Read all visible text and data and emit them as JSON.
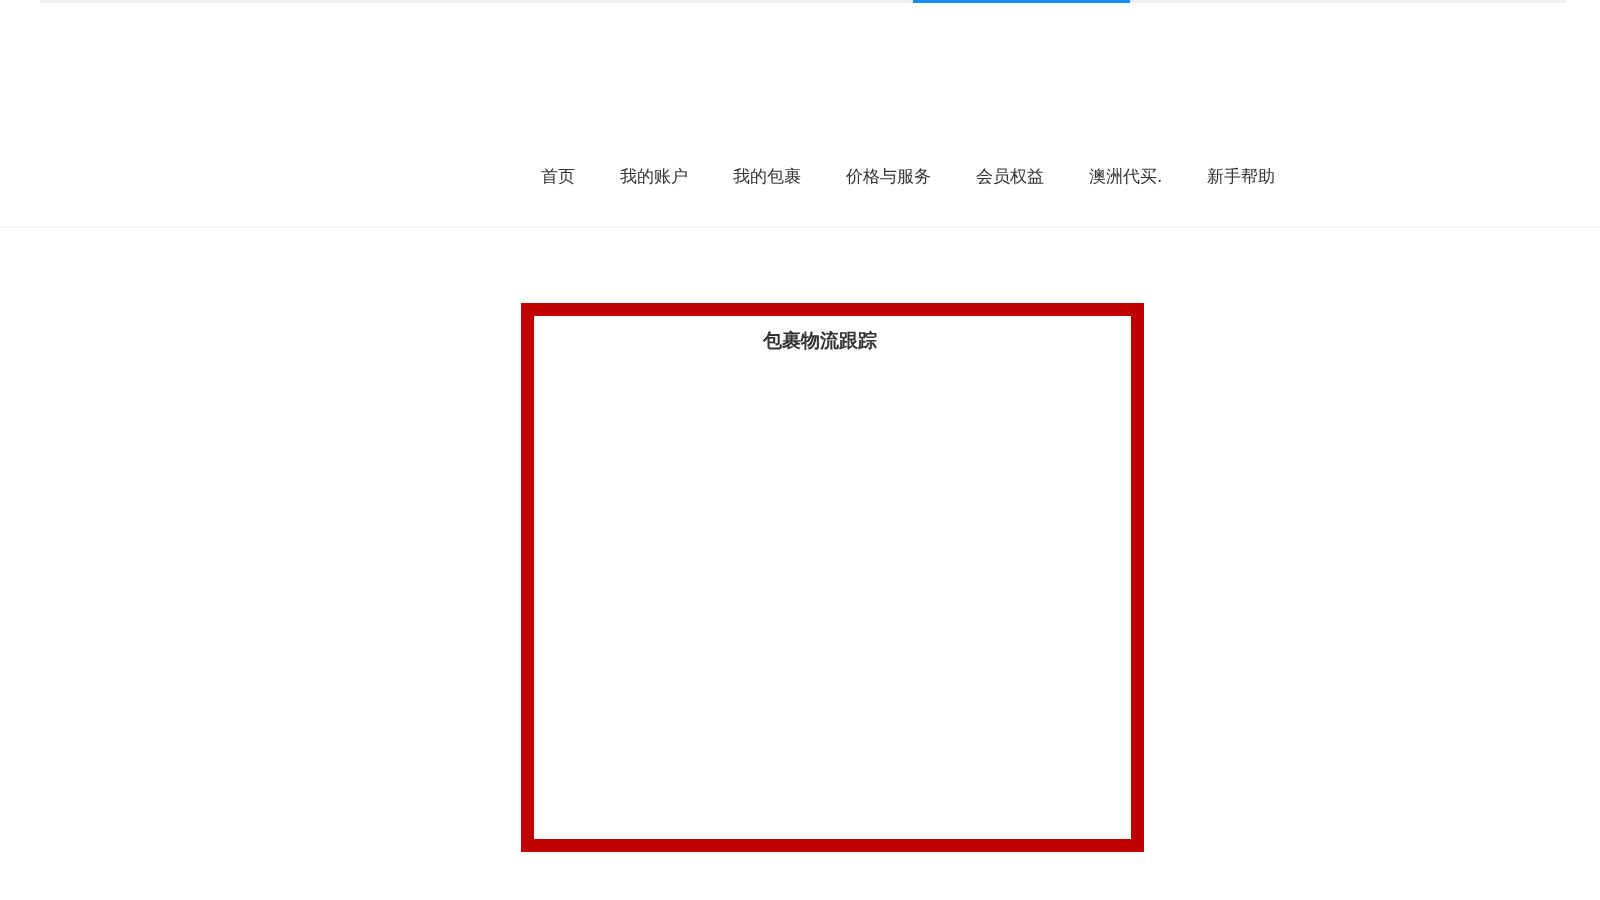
{
  "top_tabs": [
    {
      "selected": false
    },
    {
      "selected": false
    },
    {
      "selected": false
    },
    {
      "selected": false
    },
    {
      "selected": true
    },
    {
      "selected": false
    },
    {
      "selected": false
    }
  ],
  "nav": [
    "首页",
    "我的账户",
    "我的包裹",
    "价格与服务",
    "会员权益",
    "澳洲代买.",
    "新手帮助"
  ],
  "panel": {
    "title": "包裹物流跟踪",
    "highlighted": true
  }
}
